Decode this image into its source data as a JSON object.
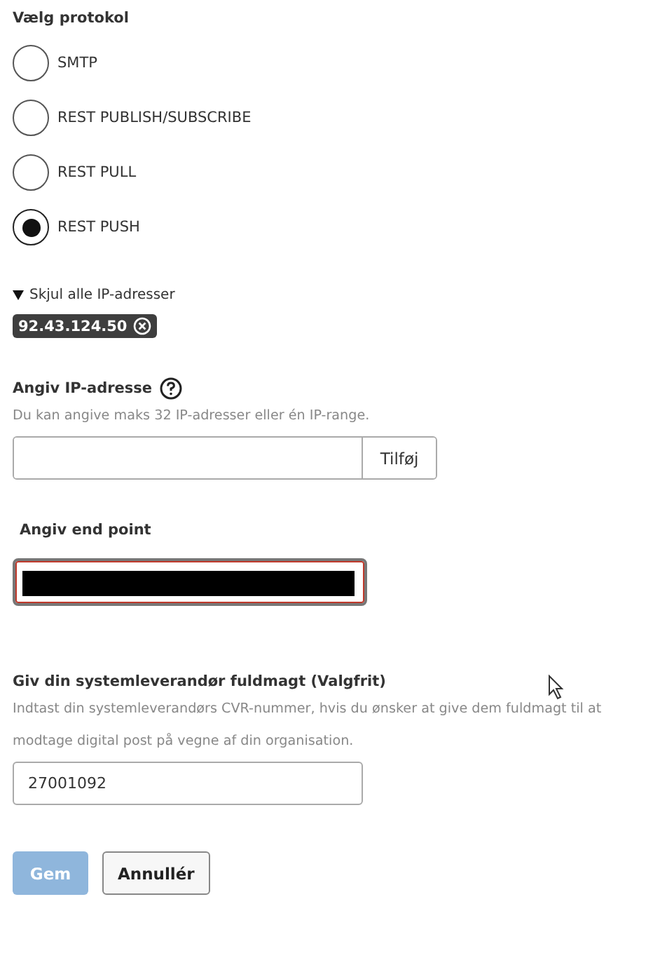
{
  "protocol": {
    "label": "Vælg protokol",
    "options": [
      {
        "label": "SMTP",
        "selected": false
      },
      {
        "label": "REST PUBLISH/SUBSCRIBE",
        "selected": false
      },
      {
        "label": "REST PULL",
        "selected": false
      },
      {
        "label": "REST PUSH",
        "selected": true
      }
    ]
  },
  "ip_list": {
    "toggle": "Skjul alle IP-adresser",
    "expanded": true,
    "chips": [
      "92.43.124.50"
    ]
  },
  "ip_input": {
    "label": "Angiv IP-adresse",
    "hint": "Du kan angive maks 32 IP-adresser eller én IP-range.",
    "button": "Tilføj"
  },
  "endpoint": {
    "label": "Angiv end point",
    "invalid": true
  },
  "proxy": {
    "label": "Giv din systemleverandør fuldmagt (Valgfrit)",
    "hint": "Indtast din systemleverandørs CVR-nummer, hvis du ønsker at give dem fuldmagt til at modtage digital post på vegne af din organisation.",
    "value": "27001092"
  },
  "buttons": [
    {
      "label": "Gem",
      "kind": "primary",
      "disabled": true
    },
    {
      "label": "Annullér",
      "kind": "secondary",
      "disabled": false
    }
  ]
}
